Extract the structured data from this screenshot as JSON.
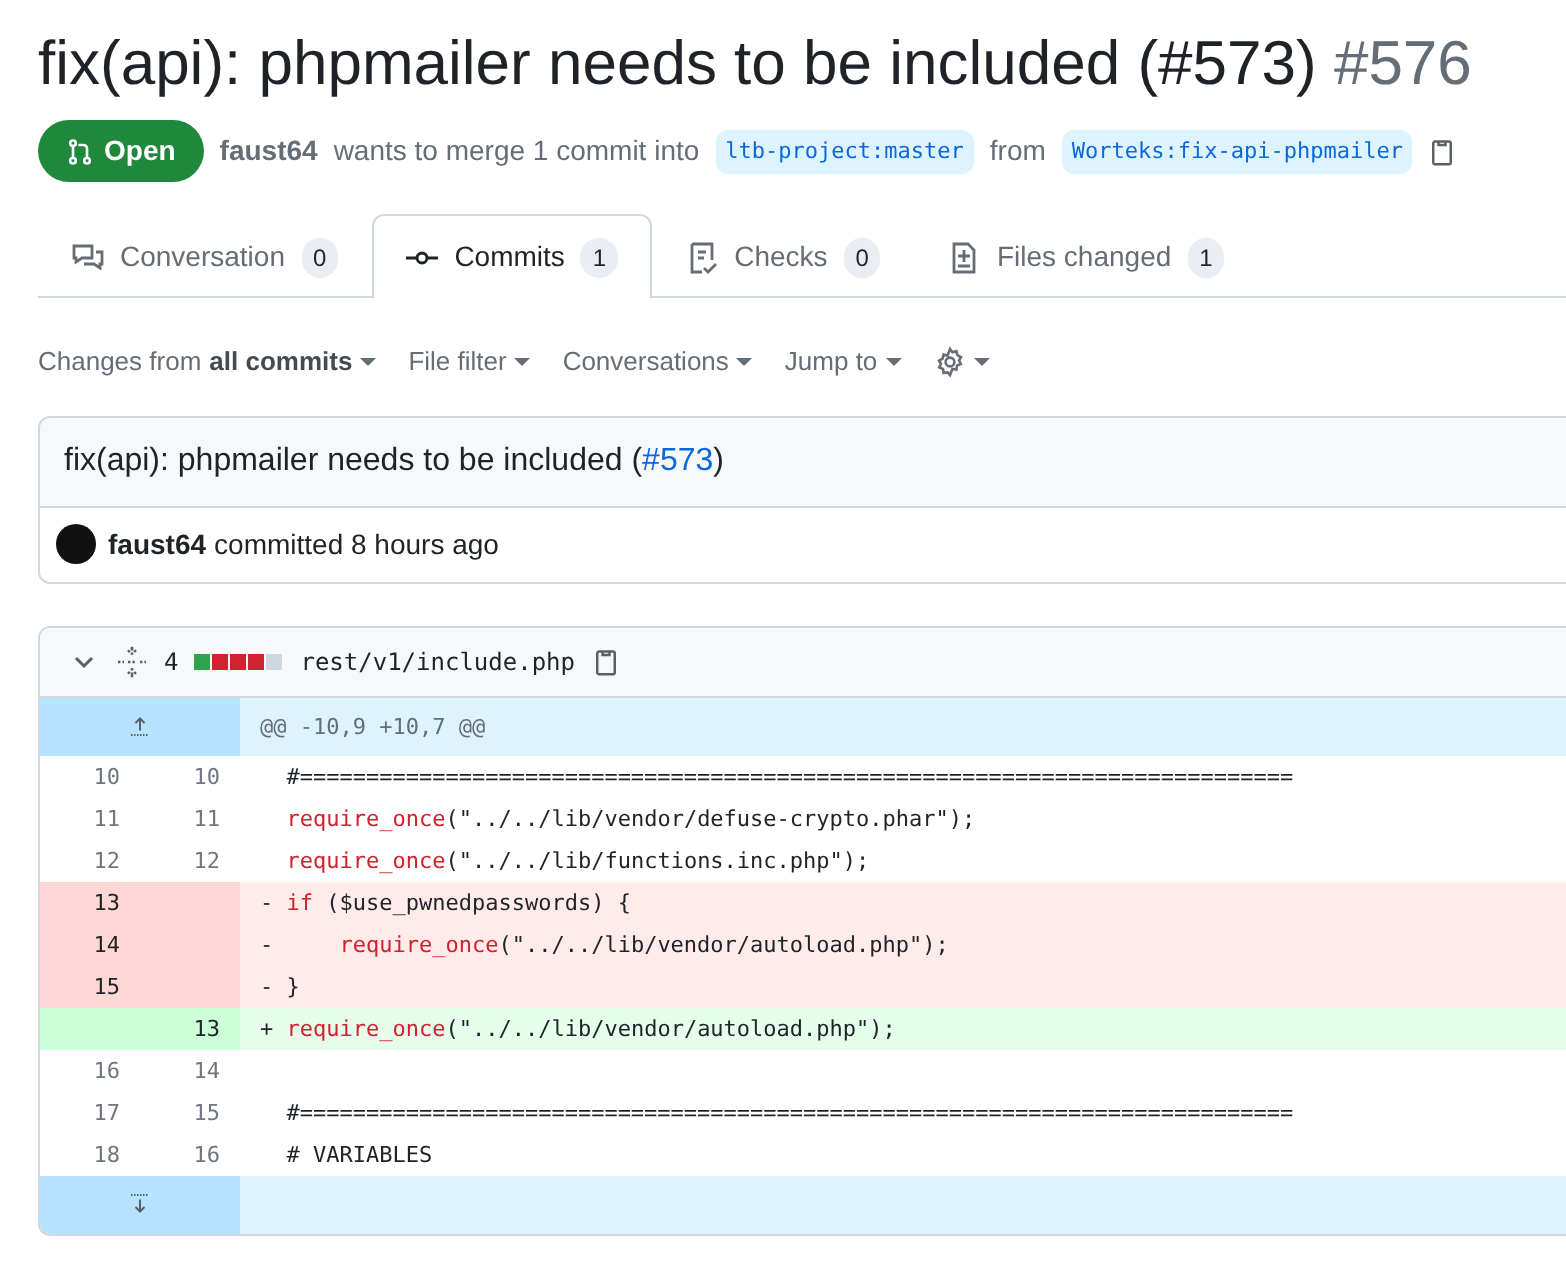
{
  "pr": {
    "title": "fix(api): phpmailer needs to be included (#573)",
    "number": "#576",
    "state": "Open",
    "author": "faust64",
    "merge_text": "wants to merge 1 commit into",
    "base": "ltb-project:master",
    "from_text": "from",
    "head": "Worteks:fix-api-phpmailer"
  },
  "tabs": [
    {
      "label": "Conversation",
      "count": "0",
      "selected": false
    },
    {
      "label": "Commits",
      "count": "1",
      "selected": true
    },
    {
      "label": "Checks",
      "count": "0",
      "selected": false
    },
    {
      "label": "Files changed",
      "count": "1",
      "selected": false
    }
  ],
  "toolbar": {
    "changes_prefix": "Changes from",
    "changes_value": "all commits",
    "items": [
      "File filter",
      "Conversations",
      "Jump to"
    ]
  },
  "commit": {
    "title_before": "fix(api): phpmailer needs to be included (",
    "link": "#573",
    "title_after": ")",
    "author": "faust64",
    "text": "committed 8 hours ago"
  },
  "file": {
    "changes": "4",
    "path": "rest/v1/include.php",
    "diffstat": [
      {
        "color": "#2da44e"
      },
      {
        "color": "#cf222e"
      },
      {
        "color": "#cf222e"
      },
      {
        "color": "#cf222e"
      },
      {
        "color": "#d0d7de"
      }
    ],
    "hunk": "@@ -10,9 +10,7 @@",
    "lines": [
      {
        "kind": "context",
        "old": "10",
        "new": "10",
        "tokens": [
          {
            "text": "#===========================================================================",
            "kind": "plain"
          }
        ]
      },
      {
        "kind": "context",
        "old": "11",
        "new": "11",
        "tokens": [
          {
            "text": "require_once",
            "kind": "keyword"
          },
          {
            "text": "(\"../../lib/vendor/defuse-crypto.phar\");",
            "kind": "plain"
          }
        ]
      },
      {
        "kind": "context",
        "old": "12",
        "new": "12",
        "tokens": [
          {
            "text": "require_once",
            "kind": "keyword"
          },
          {
            "text": "(\"../../lib/functions.inc.php\");",
            "kind": "plain"
          }
        ]
      },
      {
        "kind": "deletion",
        "old": "13",
        "sign": "-",
        "tokens": [
          {
            "text": "if",
            "kind": "keyword"
          },
          {
            "text": " ($use_pwnedpasswords) {",
            "kind": "plain"
          }
        ]
      },
      {
        "kind": "deletion",
        "old": "14",
        "sign": "-",
        "tokens": [
          {
            "text": "    require_once",
            "kind": "keyword"
          },
          {
            "text": "(\"../../lib/vendor/autoload.php\");",
            "kind": "plain"
          }
        ]
      },
      {
        "kind": "deletion",
        "old": "15",
        "sign": "-",
        "tokens": [
          {
            "text": "}",
            "kind": "plain"
          }
        ]
      },
      {
        "kind": "addition",
        "new": "13",
        "sign": "+",
        "tokens": [
          {
            "text": "require_once",
            "kind": "keyword"
          },
          {
            "text": "(\"../../lib/vendor/autoload.php\");",
            "kind": "plain"
          }
        ]
      },
      {
        "kind": "context",
        "old": "16",
        "new": "14"
      },
      {
        "kind": "context",
        "old": "17",
        "new": "15",
        "tokens": [
          {
            "text": "#===========================================================================",
            "kind": "plain"
          }
        ]
      },
      {
        "kind": "context",
        "old": "18",
        "new": "16",
        "tokens": [
          {
            "text": "# VARIABLES",
            "kind": "plain"
          }
        ]
      }
    ]
  }
}
